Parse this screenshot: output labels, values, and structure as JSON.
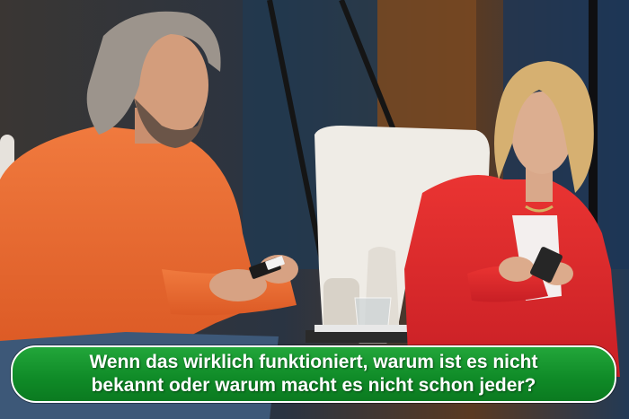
{
  "caption": {
    "line1": "Wenn das wirklich funktioniert, warum ist es nicht",
    "line2": "bekannt oder warum macht es nicht schon jeder?"
  },
  "colors": {
    "caption_green": "#149630",
    "orange_sweater": "#ef6a32",
    "red_blazer": "#e0282c"
  }
}
